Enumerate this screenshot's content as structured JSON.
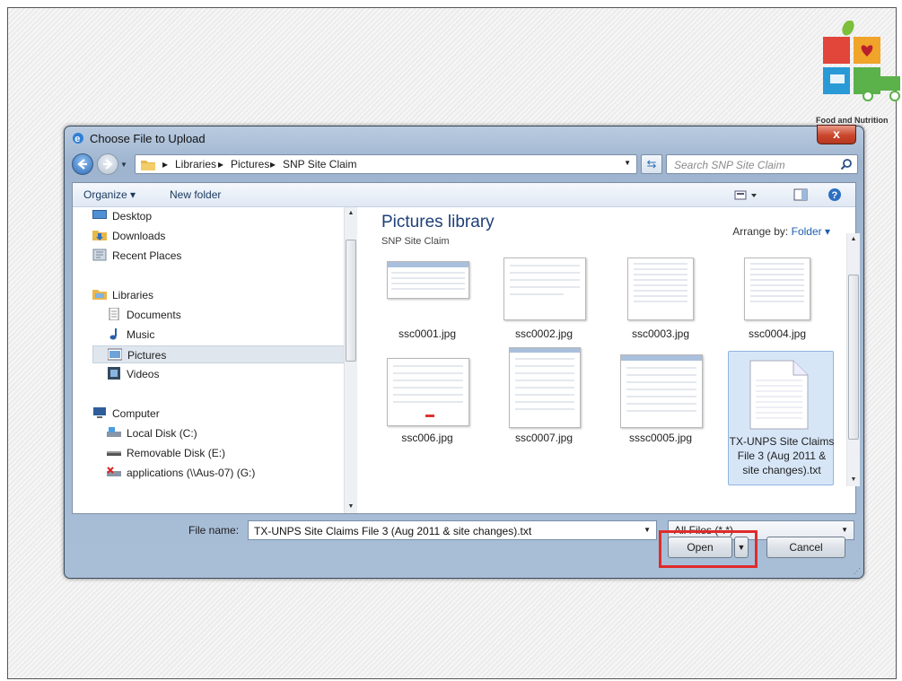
{
  "logo": {
    "caption": "Food and Nutrition"
  },
  "dialog": {
    "title": "Choose File to Upload",
    "close_label": "x",
    "address": {
      "crumbs": [
        "Libraries",
        "Pictures",
        "SNP Site Claim"
      ]
    },
    "search": {
      "placeholder": "Search SNP Site Claim"
    },
    "toolbar": {
      "organize_label": "Organize ▾",
      "new_folder_label": "New folder"
    },
    "nav": {
      "items": [
        {
          "label": "Desktop"
        },
        {
          "label": "Downloads"
        },
        {
          "label": "Recent Places"
        },
        {
          "label": "Libraries"
        },
        {
          "label": "Documents"
        },
        {
          "label": "Music"
        },
        {
          "label": "Pictures"
        },
        {
          "label": "Videos"
        },
        {
          "label": "Computer"
        },
        {
          "label": "Local Disk (C:)"
        },
        {
          "label": "Removable Disk (E:)"
        },
        {
          "label": "applications (\\\\Aus-07) (G:)"
        }
      ]
    },
    "content": {
      "library_title": "Pictures library",
      "library_subtitle": "SNP Site Claim",
      "arrange_by_label": "Arrange by:",
      "arrange_by_value": "Folder",
      "files": [
        {
          "name": "ssc0001.jpg"
        },
        {
          "name": "ssc0002.jpg"
        },
        {
          "name": "ssc0003.jpg"
        },
        {
          "name": "ssc0004.jpg"
        },
        {
          "name": "ssc006.jpg"
        },
        {
          "name": "ssc0007.jpg"
        },
        {
          "name": "sssc0005.jpg"
        },
        {
          "name": "TX-UNPS Site Claims File 3 (Aug 2011 & site changes).txt"
        }
      ]
    },
    "footer": {
      "file_name_label": "File name:",
      "file_name_value": "TX-UNPS Site Claims File 3 (Aug 2011 & site changes).txt",
      "filter_value": "All Files (*.*)",
      "open_label": "Open",
      "cancel_label": "Cancel"
    }
  },
  "colors": {
    "highlight": "#e02b2b",
    "accent": "#1e5fb0"
  }
}
